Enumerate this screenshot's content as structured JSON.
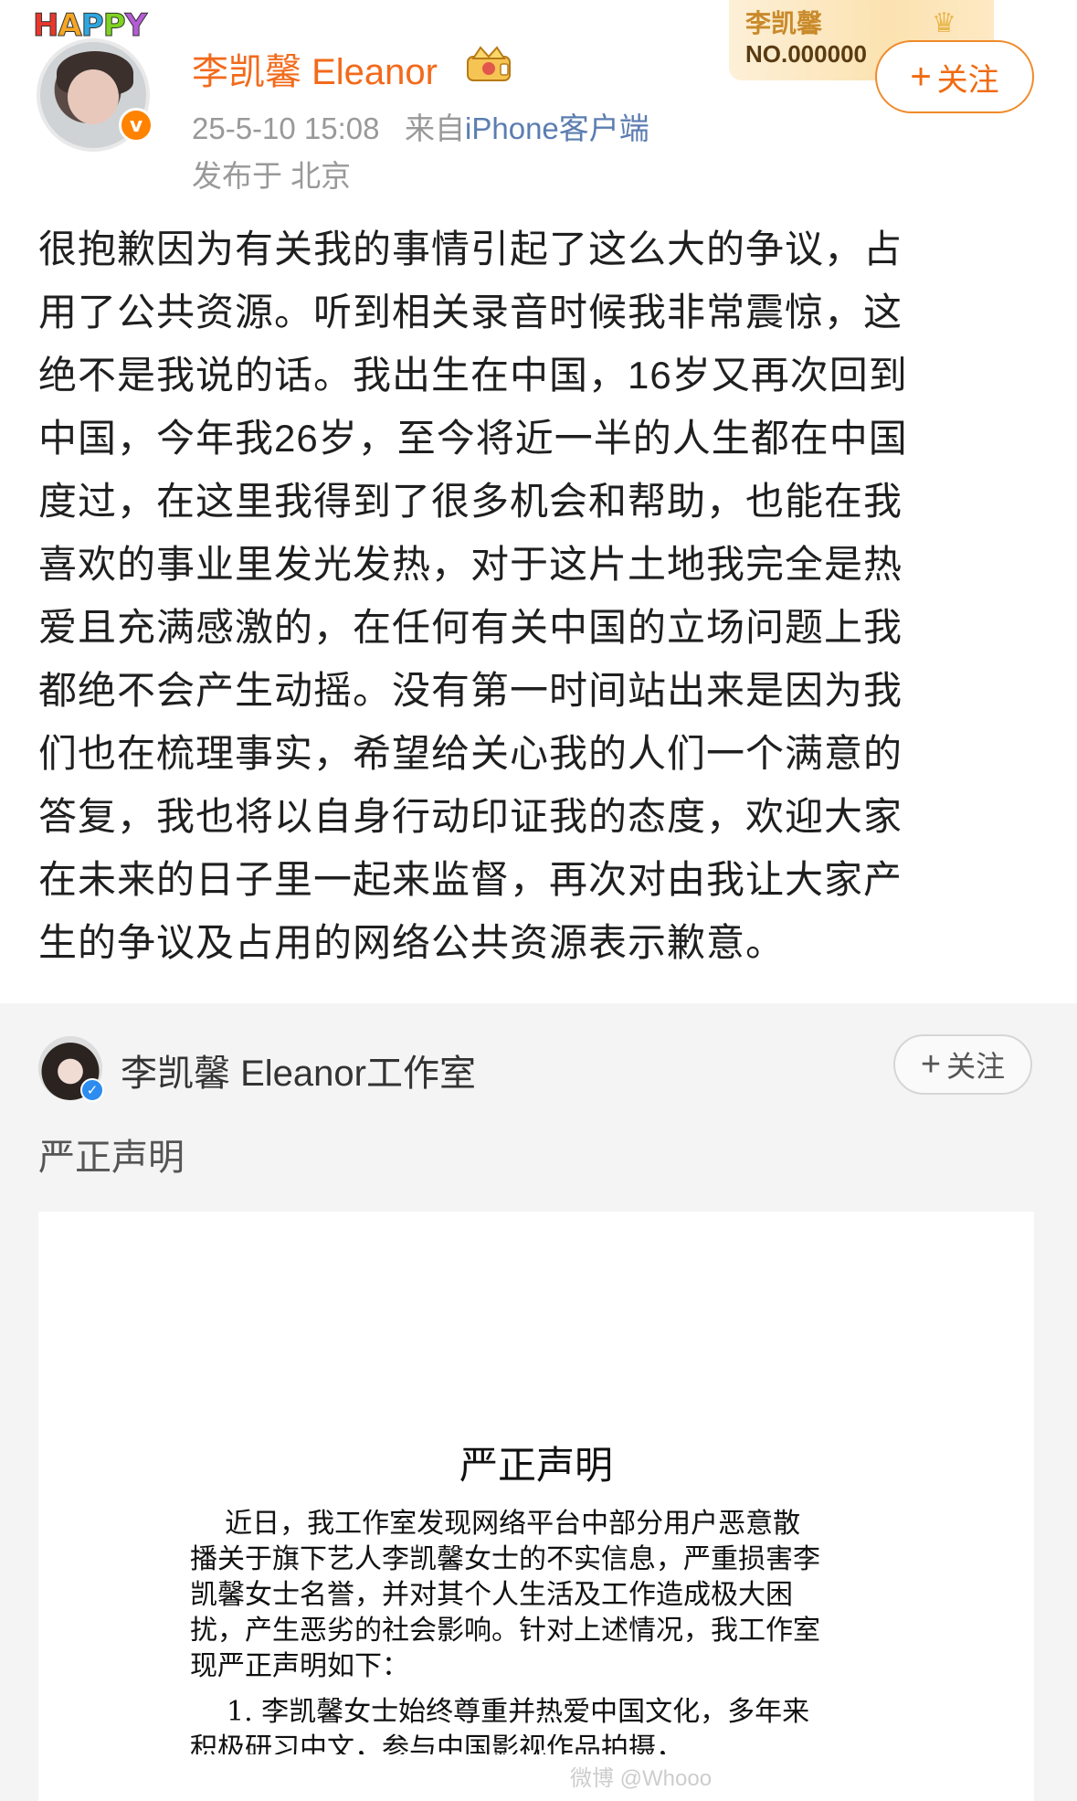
{
  "post": {
    "happy_badge": [
      "H",
      "A",
      "P",
      "P",
      "Y"
    ],
    "happy_colors": [
      "#e8372c",
      "#f5a623",
      "#2fa7e0",
      "#7ed321",
      "#b65bd6"
    ],
    "author": "李凯馨 Eleanor",
    "timestamp": "25-5-10 15:08",
    "source_prefix": "来自",
    "source": "iPhone客户端",
    "location": "发布于 北京",
    "fan_card_name": "李凯馨",
    "fan_card_number": "NO.000000",
    "follow_label": "关注",
    "body": "很抱歉因为有关我的事情引起了这么大的争议，占\n用了公共资源。听到相关录音时候我非常震惊，这\n绝不是我说的话。我出生在中国，16岁又再次回到\n中国，今年我26岁，至今将近一半的人生都在中国\n度过，在这里我得到了很多机会和帮助，也能在我\n喜欢的事业里发光发热，对于这片土地我完全是热\n爱且充满感激的，在任何有关中国的立场问题上我\n都绝不会产生动摇。没有第一时间站出来是因为我\n们也在梳理事实，希望给关心我的人们一个满意的\n答复，我也将以自身行动印证我的态度，欢迎大家\n在未来的日子里一起来监督，再次对由我让大家产\n生的争议及占用的网络公共资源表示歉意。"
  },
  "repost": {
    "author": "李凯馨 Eleanor工作室",
    "follow_label": "关注",
    "text": "严正声明",
    "doc": {
      "title": "严正声明",
      "paragraph": "    近日，我工作室发现网络平台中部分用户恶意散\n播关于旗下艺人李凯馨女士的不实信息，严重损害李\n凯馨女士名誉，并对其个人生活及工作造成极大困\n扰，产生恶劣的社会影响。针对上述情况，我工作室\n现严正声明如下：",
      "item1": "1. 李凯馨女士始终尊重并热爱中国文化，多年来",
      "item1_cont": "积极研习中文，参与中国影视作品拍摄，"
    },
    "watermark": "微博 @Whooo"
  },
  "colors": {
    "accent_orange": "#f26a1b",
    "link_blue": "#5b7db1",
    "verify_orange": "#ff8200",
    "verify_blue": "#2d8cf0",
    "repost_bg": "#f4f4f4"
  },
  "icons": [
    "verified-orange-icon",
    "crown-icon",
    "plus-icon",
    "verified-blue-icon"
  ]
}
